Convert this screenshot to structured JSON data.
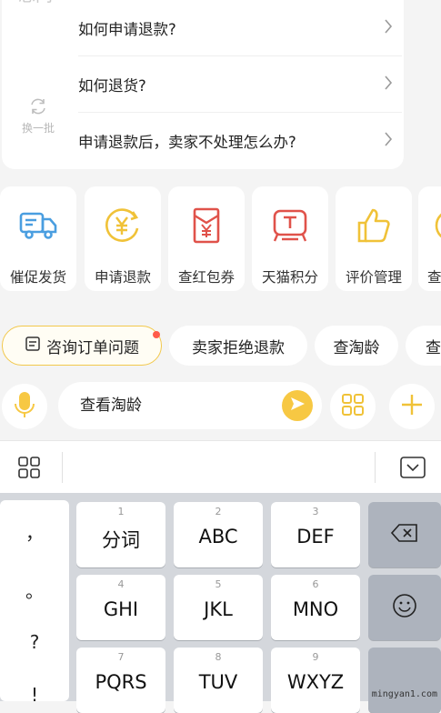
{
  "faq": {
    "side_title": "想问",
    "refresh_label": "换一批",
    "questions": [
      "如何申请退款?",
      "如何退货?",
      "申请退款后，卖家不处理怎么办?"
    ]
  },
  "services": [
    {
      "label": "催促发货",
      "icon": "truck-icon"
    },
    {
      "label": "申请退款",
      "icon": "yen-refund-icon"
    },
    {
      "label": "查红包券",
      "icon": "red-envelope-icon"
    },
    {
      "label": "天猫积分",
      "icon": "tmall-points-icon"
    },
    {
      "label": "评价管理",
      "icon": "thumbs-up-icon"
    },
    {
      "label": "查",
      "icon": "partial-icon"
    }
  ],
  "chips": [
    "咨询订单问题",
    "卖家拒绝退款",
    "查淘龄",
    "查"
  ],
  "input": {
    "value": "查看淘龄"
  },
  "keyboard": {
    "punct": [
      "，",
      "。",
      "?",
      "!"
    ],
    "keys": [
      {
        "num": "1",
        "label": "分词"
      },
      {
        "num": "2",
        "label": "ABC"
      },
      {
        "num": "3",
        "label": "DEF"
      },
      {
        "num": "4",
        "label": "GHI"
      },
      {
        "num": "5",
        "label": "JKL"
      },
      {
        "num": "6",
        "label": "MNO"
      },
      {
        "num": "7",
        "label": "PQRS"
      },
      {
        "num": "8",
        "label": "TUV"
      },
      {
        "num": "9",
        "label": "WXYZ"
      }
    ]
  },
  "watermark": "mingyan1.com",
  "colors": {
    "accent": "#f7c843",
    "blue": "#4a9ee0",
    "red": "#e0524a",
    "dot": "#ff5b4a"
  }
}
